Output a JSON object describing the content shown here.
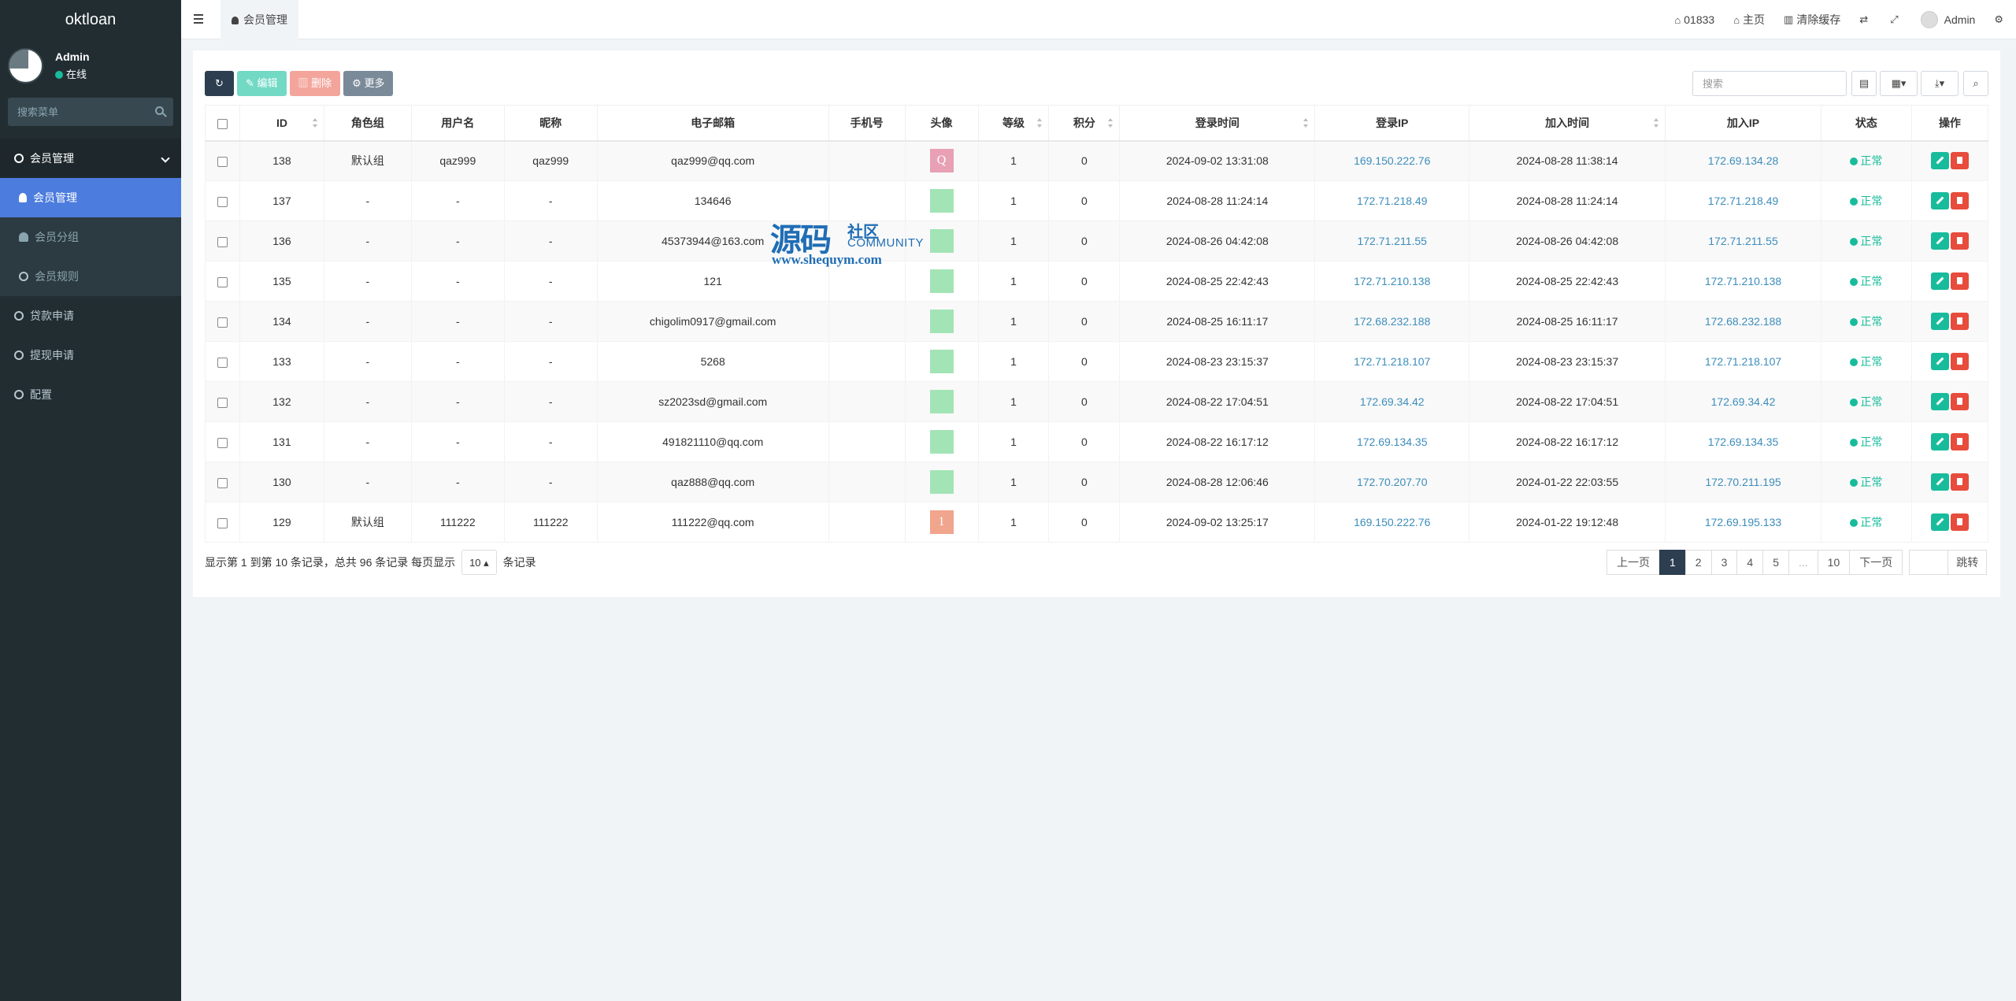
{
  "brand": "oktloan",
  "user": {
    "name": "Admin",
    "status": "在线"
  },
  "sidebar": {
    "search_placeholder": "搜索菜单",
    "items": [
      {
        "label": "会员管理",
        "type": "head"
      },
      {
        "label": "会员管理",
        "type": "active"
      },
      {
        "label": "会员分组",
        "type": "sub"
      },
      {
        "label": "会员规则",
        "type": "sub"
      },
      {
        "label": "贷款申请",
        "type": "item"
      },
      {
        "label": "提现申请",
        "type": "item"
      },
      {
        "label": "配置",
        "type": "item"
      }
    ]
  },
  "topbar": {
    "tab": "会员管理",
    "items": [
      {
        "label": "01833",
        "icon": "home-icon"
      },
      {
        "label": "主页",
        "icon": "home-icon"
      },
      {
        "label": "清除缓存",
        "icon": "trash-icon"
      }
    ],
    "admin": "Admin"
  },
  "toolbar": {
    "edit": "编辑",
    "delete": "删除",
    "more": "更多"
  },
  "search": {
    "placeholder": "搜索"
  },
  "table": {
    "columns": [
      "ID",
      "角色组",
      "用户名",
      "昵称",
      "电子邮箱",
      "手机号",
      "头像",
      "等级",
      "积分",
      "登录时间",
      "登录IP",
      "加入时间",
      "加入IP",
      "状态",
      "操作"
    ],
    "rows": [
      {
        "id": "138",
        "group": "默认组",
        "username": "qaz999",
        "nickname": "qaz999",
        "email": "qaz999@qq.com",
        "mobile": "",
        "avatar": "Q",
        "avatar_color": "#e8a0b4",
        "level": "1",
        "score": "0",
        "logintime": "2024-09-02 13:31:08",
        "loginip": "169.150.222.76",
        "jointime": "2024-08-28 11:38:14",
        "joinip": "172.69.134.28",
        "status": "正常"
      },
      {
        "id": "137",
        "group": "-",
        "username": "-",
        "nickname": "-",
        "email": "134646",
        "mobile": "",
        "avatar": "",
        "avatar_color": "#a3e4b6",
        "level": "1",
        "score": "0",
        "logintime": "2024-08-28 11:24:14",
        "loginip": "172.71.218.49",
        "jointime": "2024-08-28 11:24:14",
        "joinip": "172.71.218.49",
        "status": "正常"
      },
      {
        "id": "136",
        "group": "-",
        "username": "-",
        "nickname": "-",
        "email": "45373944@163.com",
        "mobile": "",
        "avatar": "",
        "avatar_color": "#a3e4b6",
        "level": "1",
        "score": "0",
        "logintime": "2024-08-26 04:42:08",
        "loginip": "172.71.211.55",
        "jointime": "2024-08-26 04:42:08",
        "joinip": "172.71.211.55",
        "status": "正常"
      },
      {
        "id": "135",
        "group": "-",
        "username": "-",
        "nickname": "-",
        "email": "121",
        "mobile": "",
        "avatar": "",
        "avatar_color": "#a3e4b6",
        "level": "1",
        "score": "0",
        "logintime": "2024-08-25 22:42:43",
        "loginip": "172.71.210.138",
        "jointime": "2024-08-25 22:42:43",
        "joinip": "172.71.210.138",
        "status": "正常"
      },
      {
        "id": "134",
        "group": "-",
        "username": "-",
        "nickname": "-",
        "email": "chigolim0917@gmail.com",
        "mobile": "",
        "avatar": "",
        "avatar_color": "#a3e4b6",
        "level": "1",
        "score": "0",
        "logintime": "2024-08-25 16:11:17",
        "loginip": "172.68.232.188",
        "jointime": "2024-08-25 16:11:17",
        "joinip": "172.68.232.188",
        "status": "正常"
      },
      {
        "id": "133",
        "group": "-",
        "username": "-",
        "nickname": "-",
        "email": "5268",
        "mobile": "",
        "avatar": "",
        "avatar_color": "#a3e4b6",
        "level": "1",
        "score": "0",
        "logintime": "2024-08-23 23:15:37",
        "loginip": "172.71.218.107",
        "jointime": "2024-08-23 23:15:37",
        "joinip": "172.71.218.107",
        "status": "正常"
      },
      {
        "id": "132",
        "group": "-",
        "username": "-",
        "nickname": "-",
        "email": "sz2023sd@gmail.com",
        "mobile": "",
        "avatar": "",
        "avatar_color": "#a3e4b6",
        "level": "1",
        "score": "0",
        "logintime": "2024-08-22 17:04:51",
        "loginip": "172.69.34.42",
        "jointime": "2024-08-22 17:04:51",
        "joinip": "172.69.34.42",
        "status": "正常"
      },
      {
        "id": "131",
        "group": "-",
        "username": "-",
        "nickname": "-",
        "email": "491821110@qq.com",
        "mobile": "",
        "avatar": "",
        "avatar_color": "#a3e4b6",
        "level": "1",
        "score": "0",
        "logintime": "2024-08-22 16:17:12",
        "loginip": "172.69.134.35",
        "jointime": "2024-08-22 16:17:12",
        "joinip": "172.69.134.35",
        "status": "正常"
      },
      {
        "id": "130",
        "group": "-",
        "username": "-",
        "nickname": "-",
        "email": "qaz888@qq.com",
        "mobile": "",
        "avatar": "",
        "avatar_color": "#a3e4b6",
        "level": "1",
        "score": "0",
        "logintime": "2024-08-28 12:06:46",
        "loginip": "172.70.207.70",
        "jointime": "2024-01-22 22:03:55",
        "joinip": "172.70.211.195",
        "status": "正常"
      },
      {
        "id": "129",
        "group": "默认组",
        "username": "111222",
        "nickname": "111222",
        "email": "111222@qq.com",
        "mobile": "",
        "avatar": "1",
        "avatar_color": "#f0a58c",
        "level": "1",
        "score": "0",
        "logintime": "2024-09-02 13:25:17",
        "loginip": "169.150.222.76",
        "jointime": "2024-01-22 19:12:48",
        "joinip": "172.69.195.133",
        "status": "正常"
      }
    ]
  },
  "footer": {
    "info_prefix": "显示第 1 到第 10 条记录，总共 96 条记录 每页显示",
    "page_size": "10",
    "info_suffix": "条记录"
  },
  "pager": {
    "prev": "上一页",
    "pages": [
      "1",
      "2",
      "3",
      "4",
      "5",
      "...",
      "10"
    ],
    "current": "1",
    "next": "下一页",
    "jump": "跳转"
  },
  "watermark": {
    "big": "源码",
    "she": "社区",
    "com": "COMMUNITY",
    "url": "www.shequym.com"
  }
}
